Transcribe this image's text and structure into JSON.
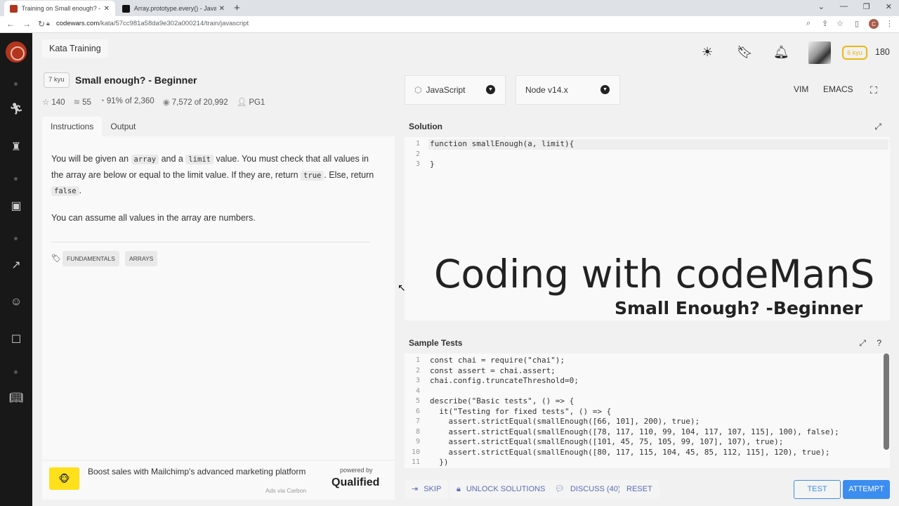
{
  "browser": {
    "tabs": [
      {
        "title": "Training on Small enough? - Beg",
        "close": "✕",
        "active": true
      },
      {
        "title": "Array.prototype.every() - JavaScr",
        "close": "✕",
        "active": false
      }
    ],
    "new_tab": "+",
    "url_host": "codewars.com",
    "url_path": "/kata/57cc981a58da9e302a000214/train/javascript",
    "profile_initial": "C"
  },
  "header": {
    "section_label": "Kata Training",
    "rank_badge": "6 kyu",
    "honor": "180"
  },
  "kata": {
    "kyu": "7 kyu",
    "title": "Small enough? - Beginner",
    "stats": {
      "stars": "140",
      "collections": "55",
      "satisfaction": "91%",
      "satisfaction_of": "of 2,360",
      "completed": "7,572",
      "completed_of": "of 20,992",
      "author": "PG1"
    },
    "tabs": [
      "Instructions",
      "Output"
    ],
    "description": {
      "p1_a": "You will be given an ",
      "code_array": "array",
      "p1_b": " and a ",
      "code_limit": "limit",
      "p1_c": " value. You must check that all values in the array are below or equal to the limit value. If they are, return ",
      "code_true": "true",
      "p1_d": ". Else, return ",
      "code_false": "false",
      "p1_e": ".",
      "p2": "You can assume all values in the array are numbers."
    },
    "tags": [
      "FUNDAMENTALS",
      "ARRAYS"
    ]
  },
  "ad": {
    "text": "Boost sales with Mailchimp's advanced marketing platform",
    "powered_by": "powered by",
    "brand": "Qualified",
    "via": "Ads via Carbon"
  },
  "editor": {
    "language": "JavaScript",
    "runtime": "Node v14.x",
    "modes": [
      "VIM",
      "EMACS"
    ],
    "solution_label": "Solution",
    "solution_lines": [
      {
        "n": "1",
        "code": "function smallEnough(a, limit){"
      },
      {
        "n": "2",
        "code": ""
      },
      {
        "n": "3",
        "code": "}"
      }
    ],
    "tests_label": "Sample Tests",
    "test_lines": [
      {
        "n": "1",
        "code": "const chai = require(\"chai\");"
      },
      {
        "n": "2",
        "code": "const assert = chai.assert;"
      },
      {
        "n": "3",
        "code": "chai.config.truncateThreshold=0;"
      },
      {
        "n": "4",
        "code": ""
      },
      {
        "n": "5",
        "code": "describe(\"Basic tests\", () => {"
      },
      {
        "n": "6",
        "code": "  it(\"Testing for fixed tests\", () => {"
      },
      {
        "n": "7",
        "code": "    assert.strictEqual(smallEnough([66, 101], 200), true);"
      },
      {
        "n": "8",
        "code": "    assert.strictEqual(smallEnough([78, 117, 110, 99, 104, 117, 107, 115], 100), false);"
      },
      {
        "n": "9",
        "code": "    assert.strictEqual(smallEnough([101, 45, 75, 105, 99, 107], 107), true);"
      },
      {
        "n": "10",
        "code": "    assert.strictEqual(smallEnough([80, 117, 115, 104, 45, 85, 112, 115], 120), true);"
      },
      {
        "n": "11",
        "code": "  })"
      }
    ]
  },
  "overlay": {
    "line1": "Coding with codeManS",
    "line2": "Small Enough? -Beginner"
  },
  "actions": {
    "skip": "SKIP",
    "unlock": "UNLOCK SOLUTIONS",
    "discuss": "DISCUSS (40)",
    "reset": "RESET",
    "test": "TEST",
    "attempt": "ATTEMPT"
  }
}
